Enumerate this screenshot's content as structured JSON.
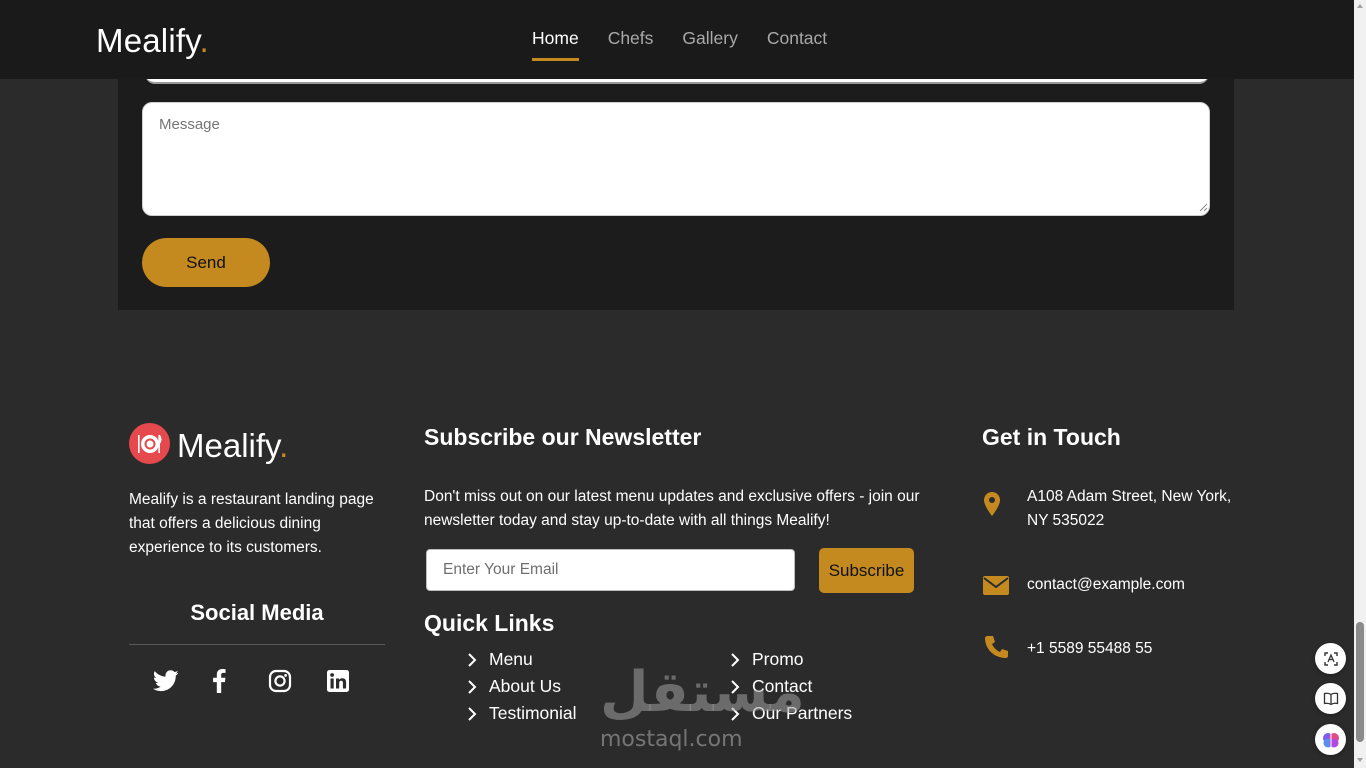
{
  "header": {
    "logo_text": "Mealify",
    "logo_dot": ".",
    "nav": [
      {
        "label": "Home",
        "active": true
      },
      {
        "label": "Chefs",
        "active": false
      },
      {
        "label": "Gallery",
        "active": false
      },
      {
        "label": "Contact",
        "active": false
      }
    ]
  },
  "contact_form": {
    "message_placeholder": "Message",
    "message_value": "",
    "send_label": "Send"
  },
  "footer": {
    "brand": {
      "name": "Mealify",
      "dot": ".",
      "description": "Mealify is a restaurant landing page that offers a delicious dining experience to its customers.",
      "icon": "plate-cutlery-icon"
    },
    "social": {
      "title": "Social Media",
      "icons": [
        "twitter-icon",
        "facebook-icon",
        "instagram-icon",
        "linkedin-icon"
      ]
    },
    "newsletter": {
      "title": "Subscribe our Newsletter",
      "text": "Don't miss out on our latest menu updates and exclusive offers - join our newsletter today and stay up-to-date with all things Mealify!",
      "email_placeholder": "Enter Your Email",
      "email_value": "",
      "subscribe_label": "Subscribe"
    },
    "quick_links": {
      "title": "Quick Links",
      "col1": [
        "Menu",
        "About Us",
        "Testimonial"
      ],
      "col2": [
        "Promo",
        "Contact",
        "Our Partners"
      ]
    },
    "touch": {
      "title": "Get in Touch",
      "address": "A108 Adam Street, New York, NY 535022",
      "email": "contact@example.com",
      "phone": "+1 5589 55488 55"
    }
  },
  "watermark": {
    "arabic": "مستقل",
    "latin": "mostaql.com"
  },
  "colors": {
    "accent": "#c48a1f",
    "header_bg": "#1a1a1a",
    "page_bg": "#2b2b2b",
    "card_bg": "#1c1c1c",
    "brand_icon_bg": "#e5484d"
  }
}
